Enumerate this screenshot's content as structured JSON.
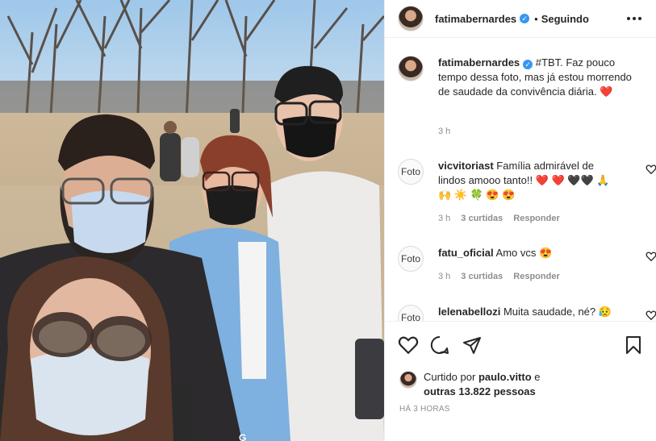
{
  "post": {
    "photo_alt": "",
    "shirt_text": "G"
  },
  "header": {
    "username": "fatimabernardes",
    "separator": "•",
    "follow_state": "Seguindo"
  },
  "caption": {
    "username": "fatimabernardes",
    "text": "#TBT. Faz pouco tempo dessa foto, mas já estou morrendo de saudade da convivência diária.",
    "emoji": "❤️",
    "time": "3 h"
  },
  "comments": [
    {
      "avatar_text": "Foto",
      "username": "vicvitoriast",
      "text": "Família admirável de lindos amooo tanto!!",
      "emoji": "❤️ ❤️ 🖤🖤 🙏 🙌 ☀️ 🍀 😍 😍",
      "time": "3 h",
      "likes": "3 curtidas",
      "reply": "Responder"
    },
    {
      "avatar_text": "Foto",
      "username": "fatu_oficial",
      "text": "Amo vcs",
      "emoji": "😍",
      "time": "3 h",
      "likes": "3 curtidas",
      "reply": "Responder"
    },
    {
      "avatar_text": "Foto",
      "username": "lelenabellozi",
      "text": "Muita saudade, né?",
      "emoji": "😥",
      "time": "",
      "likes": "",
      "reply": ""
    }
  ],
  "likes": {
    "prefix": "Curtido por",
    "user": "paulo.vitto",
    "connector": "e",
    "others": "outras 13.822 pessoas"
  },
  "timestamp": "HÁ 3 HORAS",
  "colors": {
    "text": "#262626",
    "muted": "#8e8e8e",
    "verified": "#3897f0",
    "border": "#efefef"
  }
}
